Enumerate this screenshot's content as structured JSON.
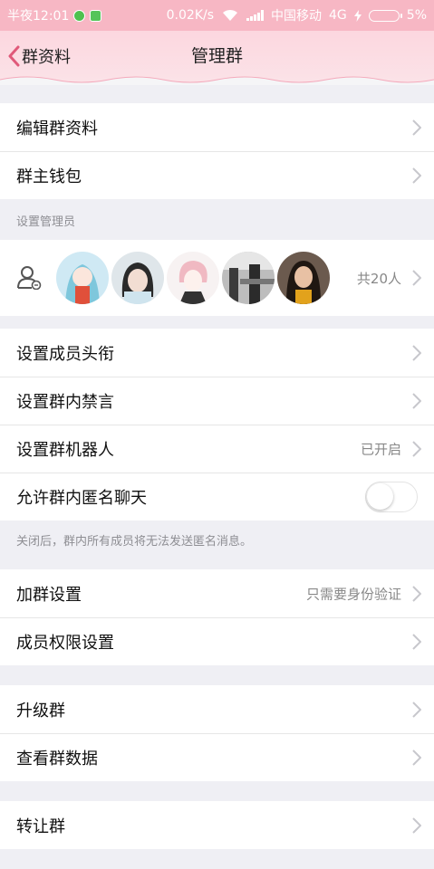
{
  "status_bar": {
    "time": "半夜12:01",
    "speed": "0.02K/s",
    "carrier": "中国移动",
    "network": "4G",
    "battery": "5%"
  },
  "nav": {
    "back_label": "群资料",
    "title": "管理群"
  },
  "group1": {
    "items": [
      {
        "label": "编辑群资料"
      },
      {
        "label": "群主钱包"
      }
    ]
  },
  "admins": {
    "section_label": "设置管理员",
    "count_label": "共20人",
    "avatars": [
      "avatar-1",
      "avatar-2",
      "avatar-3",
      "avatar-4",
      "avatar-5"
    ]
  },
  "group2": {
    "items": [
      {
        "label": "设置成员头衔"
      },
      {
        "label": "设置群内禁言"
      },
      {
        "label": "设置群机器人",
        "value": "已开启"
      },
      {
        "label": "允许群内匿名聊天",
        "toggle": false
      }
    ],
    "footnote": "关闭后，群内所有成员将无法发送匿名消息。"
  },
  "group3": {
    "items": [
      {
        "label": "加群设置",
        "value": "只需要身份验证"
      },
      {
        "label": "成员权限设置"
      }
    ]
  },
  "group4": {
    "items": [
      {
        "label": "升级群"
      },
      {
        "label": "查看群数据"
      }
    ]
  },
  "group5": {
    "items": [
      {
        "label": "转让群"
      }
    ]
  },
  "colors": {
    "status_bar": "#f7b7c4",
    "nav_bar": "#fcd7df",
    "background": "#efeff4",
    "chevron": "#c7c7cc",
    "back_arrow": "#e05a7a"
  }
}
